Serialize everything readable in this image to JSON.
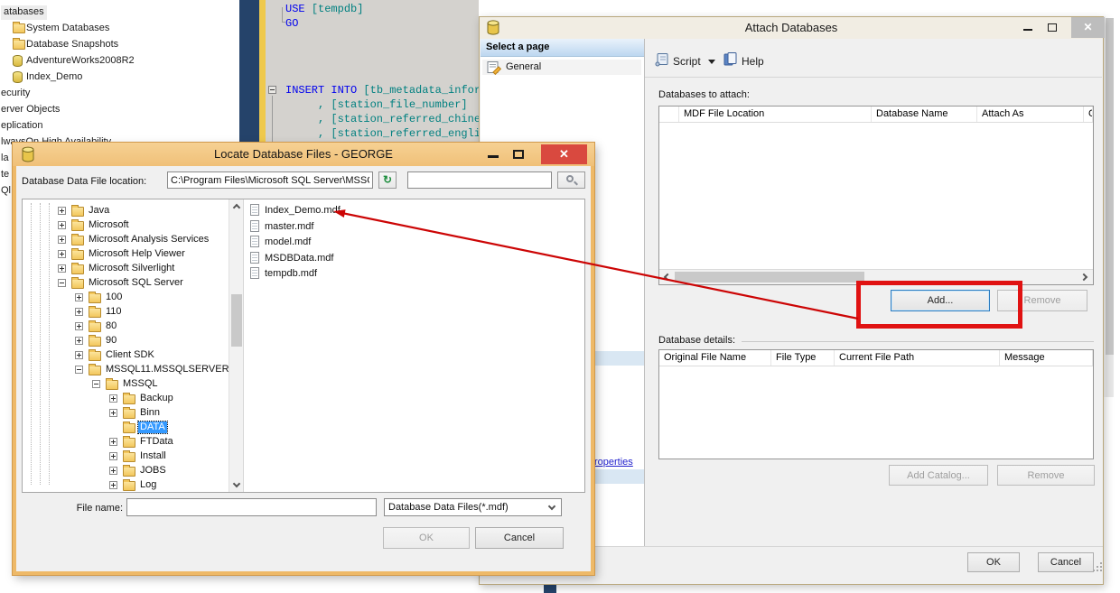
{
  "colors": {
    "annotation_red": "#e01212",
    "selection_blue": "#3399ff",
    "active_title_orange": "#f0c078",
    "link_blue": "#1f1fcc",
    "sql_keyword": "#0000ee",
    "sql_identifier": "#008080"
  },
  "explorer": {
    "items": [
      {
        "label": "atabases",
        "icon": null,
        "selected": true
      },
      {
        "label": "System Databases",
        "icon": "folder"
      },
      {
        "label": "Database Snapshots",
        "icon": "folder"
      },
      {
        "label": "AdventureWorks2008R2",
        "icon": "database"
      },
      {
        "label": "Index_Demo",
        "icon": "database"
      },
      {
        "label": "ecurity",
        "icon": null
      },
      {
        "label": "erver Objects",
        "icon": null
      },
      {
        "label": "eplication",
        "icon": null
      },
      {
        "label": "lwaysOn High Availability",
        "icon": null
      },
      {
        "label": "la",
        "icon": null
      },
      {
        "label": "te",
        "icon": null
      },
      {
        "label": "Ql",
        "icon": null
      }
    ]
  },
  "editor": {
    "lines": [
      {
        "indent": 0,
        "segments": [
          {
            "text": "USE ",
            "color": "keyword"
          },
          {
            "text": "[tempdb]",
            "color": "identifier"
          }
        ]
      },
      {
        "indent": 0,
        "segments": [
          {
            "text": "GO",
            "color": "keyword"
          }
        ]
      },
      {
        "indent": 0,
        "collapse": true,
        "segments": [
          {
            "text": "INSERT INTO ",
            "color": "keyword"
          },
          {
            "text": "[tb_metadata_inform",
            "color": "identifier"
          }
        ]
      },
      {
        "indent": 1,
        "segments": [
          {
            "text": ", [station_file_number]",
            "color": "identifier"
          }
        ]
      },
      {
        "indent": 1,
        "segments": [
          {
            "text": ", [station_referred_chines",
            "color": "identifier"
          }
        ]
      },
      {
        "indent": 1,
        "segments": [
          {
            "text": ", [station_referred_englis",
            "color": "identifier"
          }
        ]
      }
    ]
  },
  "attach": {
    "title": "Attach Databases",
    "select_page_header": "Select a page",
    "page_general": "General",
    "script_label": "Script",
    "help_label": "Help",
    "databases_label": "Databases to attach:",
    "grid_columns": [
      "",
      "MDF File Location",
      "Database Name",
      "Attach As",
      "O"
    ],
    "add_label": "Add...",
    "remove_label": "Remove",
    "details_label": "Database details:",
    "details_columns": [
      "Original File Name",
      "File Type",
      "Current File Path",
      "Message"
    ],
    "add_catalog_label": "Add Catalog...",
    "remove2_label": "Remove",
    "ok_label": "OK",
    "cancel_label": "Cancel",
    "link_fragment": "roperties"
  },
  "locate": {
    "title": "Locate Database Files - GEORGE",
    "location_label": "Database Data File location:",
    "location_value": "C:\\Program Files\\Microsoft SQL Server\\MSSQ",
    "search_value": "",
    "tree": [
      {
        "label": "Java",
        "level": 0,
        "expand": "plus"
      },
      {
        "label": "Microsoft",
        "level": 0,
        "expand": "plus"
      },
      {
        "label": "Microsoft Analysis Services",
        "level": 0,
        "expand": "plus"
      },
      {
        "label": "Microsoft Help Viewer",
        "level": 0,
        "expand": "plus"
      },
      {
        "label": "Microsoft Silverlight",
        "level": 0,
        "expand": "plus"
      },
      {
        "label": "Microsoft SQL Server",
        "level": 0,
        "expand": "minus"
      },
      {
        "label": "100",
        "level": 1,
        "expand": "plus"
      },
      {
        "label": "110",
        "level": 1,
        "expand": "plus"
      },
      {
        "label": "80",
        "level": 1,
        "expand": "plus"
      },
      {
        "label": "90",
        "level": 1,
        "expand": "plus"
      },
      {
        "label": "Client SDK",
        "level": 1,
        "expand": "plus"
      },
      {
        "label": "MSSQL11.MSSQLSERVER",
        "level": 1,
        "expand": "minus"
      },
      {
        "label": "MSSQL",
        "level": 2,
        "expand": "minus"
      },
      {
        "label": "Backup",
        "level": 3,
        "expand": "plus"
      },
      {
        "label": "Binn",
        "level": 3,
        "expand": "plus"
      },
      {
        "label": "DATA",
        "level": 3,
        "expand": "none",
        "selected": true
      },
      {
        "label": "FTData",
        "level": 3,
        "expand": "plus"
      },
      {
        "label": "Install",
        "level": 3,
        "expand": "plus"
      },
      {
        "label": "JOBS",
        "level": 3,
        "expand": "plus"
      },
      {
        "label": "Log",
        "level": 3,
        "expand": "plus"
      }
    ],
    "files": [
      "Index_Demo.mdf",
      "master.mdf",
      "model.mdf",
      "MSDBData.mdf",
      "tempdb.mdf"
    ],
    "file_name_label": "File name:",
    "file_name_value": "",
    "file_type_value": "Database Data Files(*.mdf)",
    "ok_label": "OK",
    "cancel_label": "Cancel"
  }
}
